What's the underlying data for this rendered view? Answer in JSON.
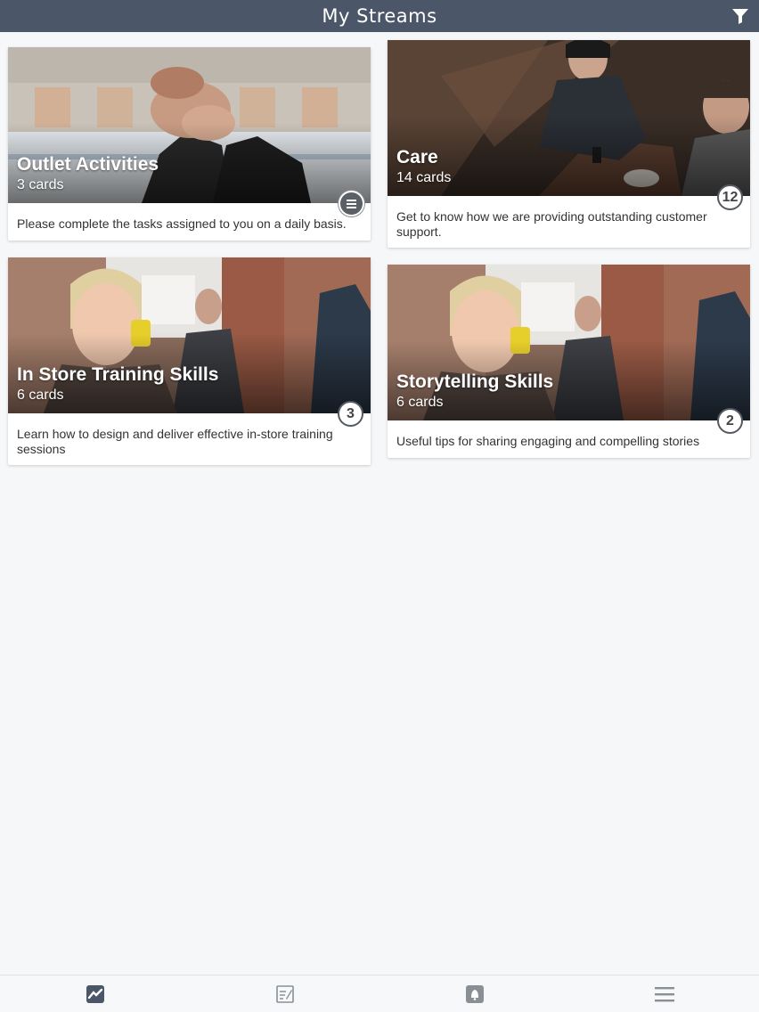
{
  "header": {
    "title": "My Streams",
    "filter_icon": "filter-icon"
  },
  "streams": [
    {
      "title": "Outlet Activities",
      "count": "3 cards",
      "description": "Please complete the tasks assigned to you on a daily basis.",
      "badge_icon": "list-icon",
      "image": "handshake-photo"
    },
    {
      "title": "Care",
      "count": "14 cards",
      "description": "Get to know how we are providing outstanding customer support.",
      "badge": "12",
      "image": "cafe-meeting-photo"
    },
    {
      "title": "In Store Training Skills",
      "count": "6 cards",
      "description": "Learn how to design and deliver effective in-store training sessions",
      "badge": "3",
      "image": "woman-on-phone-photo"
    },
    {
      "title": "Storytelling Skills",
      "count": "6 cards",
      "description": "Useful tips for sharing engaging and compelling stories",
      "badge": "2",
      "image": "woman-on-phone-photo"
    }
  ],
  "bottom_nav": [
    {
      "icon": "streams-icon",
      "active": true
    },
    {
      "icon": "notes-icon",
      "active": false
    },
    {
      "icon": "notifications-icon",
      "active": false
    },
    {
      "icon": "menu-icon",
      "active": false
    }
  ],
  "colors": {
    "header_bg": "#4b5668",
    "page_bg": "#f5f7f9",
    "card_bg": "#ffffff",
    "nav_icon_active": "#4b5668",
    "nav_icon_inactive": "#8a8f96"
  }
}
